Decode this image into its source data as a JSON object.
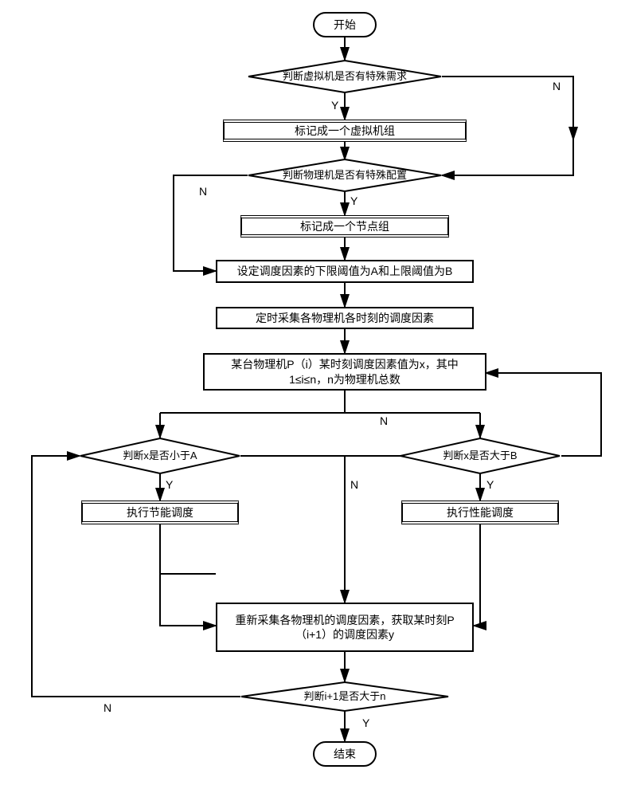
{
  "chart_data": {
    "type": "flowchart",
    "nodes": [
      {
        "id": "start",
        "type": "terminator",
        "text": "开始"
      },
      {
        "id": "d1",
        "type": "decision",
        "text": "判断虚拟机是否有特殊需求"
      },
      {
        "id": "p1",
        "type": "process",
        "text": "标记成一个虚拟机组"
      },
      {
        "id": "d2",
        "type": "decision",
        "text": "判断物理机是否有特殊配置"
      },
      {
        "id": "p2",
        "type": "process",
        "text": "标记成一个节点组"
      },
      {
        "id": "p3",
        "type": "process",
        "text": "设定调度因素的下限阈值为A和上限阈值为B"
      },
      {
        "id": "p4",
        "type": "process",
        "text": "定时采集各物理机各时刻的调度因素"
      },
      {
        "id": "p5",
        "type": "process",
        "text": "某台物理机P（i）某时刻调度因素值为x，其中1≤i≤n，n为物理机总数"
      },
      {
        "id": "d3",
        "type": "decision",
        "text": "判断x是否小于A"
      },
      {
        "id": "p6",
        "type": "process",
        "text": "执行节能调度"
      },
      {
        "id": "d4",
        "type": "decision",
        "text": "判断x是否大于B"
      },
      {
        "id": "p7",
        "type": "process",
        "text": "执行性能调度"
      },
      {
        "id": "p8",
        "type": "process",
        "text": "重新采集各物理机的调度因素，获取某时刻P（i+1）的调度因素y"
      },
      {
        "id": "d5",
        "type": "decision",
        "text": "判断i+1是否大于n"
      },
      {
        "id": "end",
        "type": "terminator",
        "text": "结束"
      }
    ],
    "edges": [
      {
        "from": "start",
        "to": "d1"
      },
      {
        "from": "d1",
        "to": "p1",
        "label": "Y"
      },
      {
        "from": "d1",
        "to": "d2",
        "label": "N",
        "route": "right-down"
      },
      {
        "from": "p1",
        "to": "d2"
      },
      {
        "from": "d2",
        "to": "p2",
        "label": "Y"
      },
      {
        "from": "d2",
        "to": "p3",
        "label": "N",
        "route": "left-down"
      },
      {
        "from": "p2",
        "to": "p3"
      },
      {
        "from": "p3",
        "to": "p4"
      },
      {
        "from": "p4",
        "to": "p5"
      },
      {
        "from": "p5",
        "to": "d3",
        "route": "down-left"
      },
      {
        "from": "d3",
        "to": "p6",
        "label": "Y"
      },
      {
        "from": "d3",
        "to": "d4",
        "label": "N",
        "route": "right"
      },
      {
        "from": "d4",
        "to": "p7",
        "label": "Y"
      },
      {
        "from": "d4",
        "to": "p8",
        "label": "N",
        "route": "left-down"
      },
      {
        "from": "p6",
        "to": "p8"
      },
      {
        "from": "p7",
        "to": "p8"
      },
      {
        "from": "p8",
        "to": "d5"
      },
      {
        "from": "d5",
        "to": "end",
        "label": "Y"
      },
      {
        "from": "d5",
        "to": "d3",
        "label": "N",
        "route": "left-up"
      }
    ]
  },
  "labels": {
    "yes": "Y",
    "no": "N"
  },
  "nodes": {
    "start": "开始",
    "d1": "判断虚拟机是否有特殊需求",
    "p1": "标记成一个虚拟机组",
    "d2": "判断物理机是否有特殊配置",
    "p2": "标记成一个节点组",
    "p3": "设定调度因素的下限阈值为A和上限阈值为B",
    "p4": "定时采集各物理机各时刻的调度因素",
    "p5": "某台物理机P（i）某时刻调度因素值为x，其中\n1≤i≤n，n为物理机总数",
    "d3": "判断x是否小于A",
    "p6": "执行节能调度",
    "d4": "判断x是否大于B",
    "p7": "执行性能调度",
    "p8": "重新采集各物理机的调度因素，获取某时刻P\n（i+1）的调度因素y",
    "d5": "判断i+1是否大于n",
    "end": "结束"
  }
}
